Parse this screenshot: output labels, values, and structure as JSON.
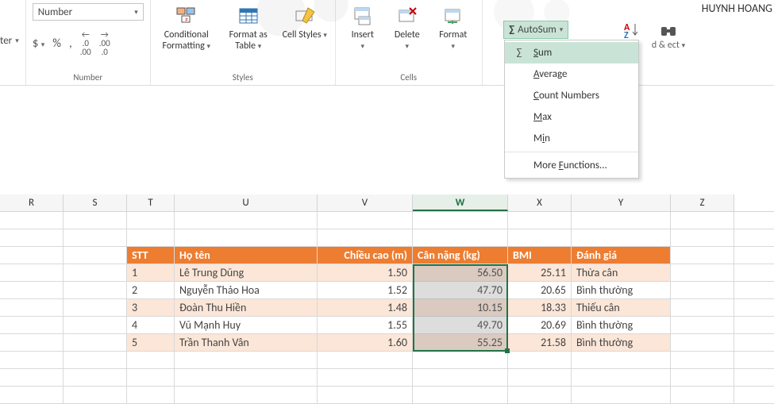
{
  "author_tag": "HUYNH HOANG",
  "ribbon": {
    "number_format": "Number",
    "number_group": "Number",
    "styles_group": "Styles",
    "cells_group": "Cells",
    "center_label": "ter",
    "dollar": "$",
    "percent": "%",
    "comma": ",",
    "inc_dec_a": ".0",
    "inc_dec_b": ".00",
    "cond_fmt": "Conditional Formatting",
    "fmt_table": "Format as Table",
    "cell_styles": "Cell Styles",
    "insert": "Insert",
    "delete": "Delete",
    "format": "Format",
    "autosum": "AutoSum",
    "sort_filter_partial": "d & ect"
  },
  "autosum_menu": {
    "sum": "Sum",
    "average": "Average",
    "count": "Count Numbers",
    "max": "Max",
    "min": "Min",
    "more": "More Functions..."
  },
  "columns": [
    "R",
    "S",
    "T",
    "U",
    "V",
    "W",
    "X",
    "Y",
    "Z"
  ],
  "table": {
    "headers": {
      "stt": "STT",
      "name": "Họ tên",
      "height": "Chiều cao (m)",
      "weight": "Cân nặng (kg)",
      "bmi": "BMI",
      "note": "Đánh giá"
    },
    "rows": [
      {
        "stt": "1",
        "name": "Lê Trung Dũng",
        "height": "1.50",
        "weight": "56.50",
        "bmi": "25.11",
        "note": "Thừa cân"
      },
      {
        "stt": "2",
        "name": "Nguyễn Thảo Hoa",
        "height": "1.52",
        "weight": "47.70",
        "bmi": "20.65",
        "note": "Bình thường"
      },
      {
        "stt": "3",
        "name": "Đoàn Thu Hiền",
        "height": "1.48",
        "weight": "10.15",
        "bmi": "18.33",
        "note": "Thiếu cân"
      },
      {
        "stt": "4",
        "name": "Vũ Mạnh Huy",
        "height": "1.55",
        "weight": "49.70",
        "bmi": "20.69",
        "note": "Bình thường"
      },
      {
        "stt": "5",
        "name": "Trần Thanh Vân",
        "height": "1.60",
        "weight": "55.25",
        "bmi": "21.58",
        "note": "Bình thường"
      }
    ]
  }
}
